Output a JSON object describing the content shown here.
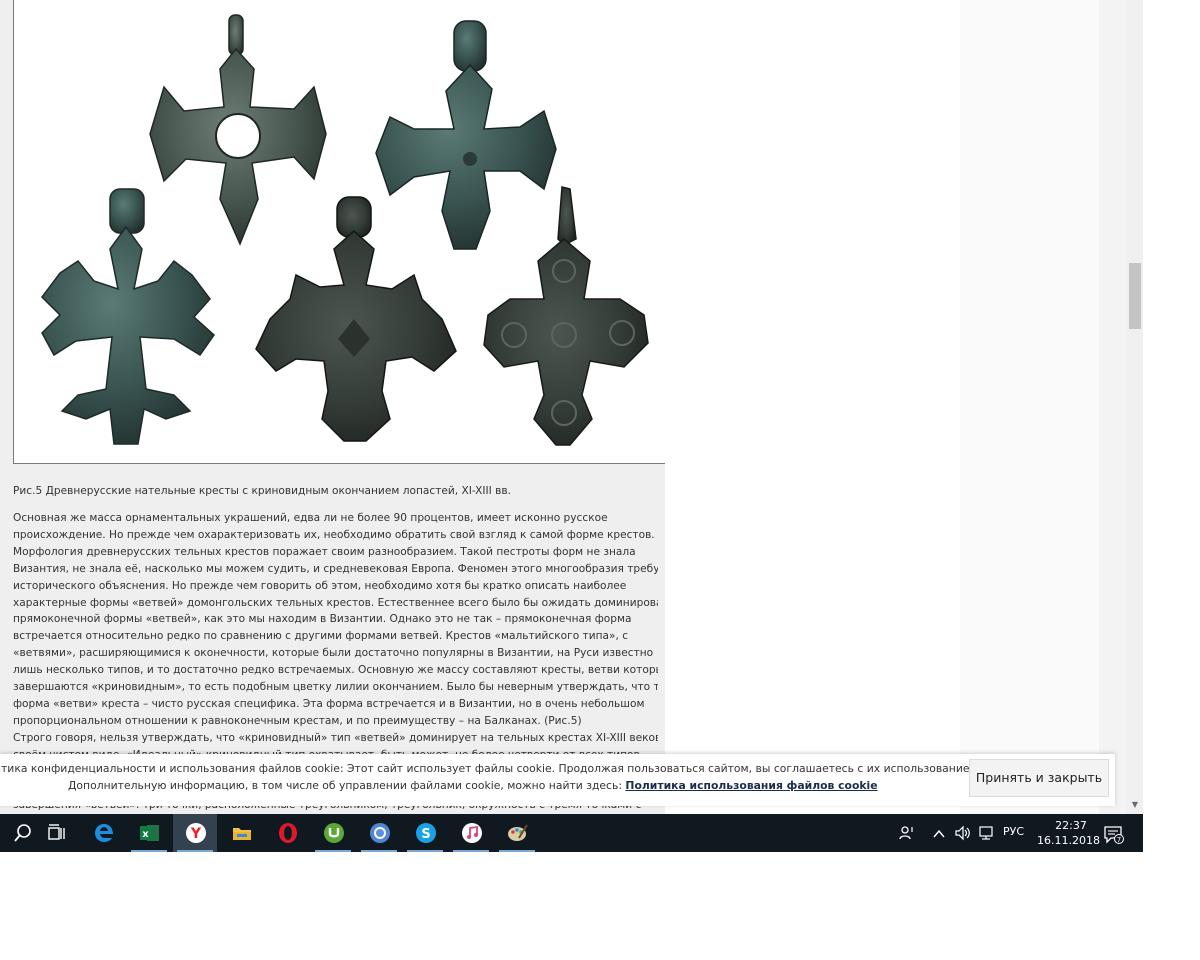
{
  "article": {
    "caption": "Рис.5 Древнерусские нательные кресты с криновидным окончанием лопастей, XI-XIII вв.",
    "lines": [
      "Основная же масса орнаментальных украшений, едва ли не более 90 процентов, имеет исконно русское",
      "происхождение. Но прежде чем охарактеризовать их, необходимо обратить свой взгляд к самой форме крестов.",
      "Морфология древнерусских тельных крестов поражает своим разнообразием. Такой пестроты форм не знала",
      "Византия, не знала её, насколько мы можем судить, и средневековая Европа. Феномен этого многообразия требует",
      "исторического объяснения. Но прежде чем говорить об этом, необходимо хотя бы кратко описать наиболее",
      "характерные формы «ветвей» домонгольских тельных крестов. Естественнее всего было бы ожидать доминирование",
      "прямоконечной формы «ветвей», как это мы находим в Византии. Однако это не так – прямоконечная форма",
      "встречается относительно редко по сравнению с другими формами ветвей. Крестов «мальтийского типа», с",
      "«ветвями», расширяющимися к оконечности, которые были достаточно популярны в Византии, на Руси известно",
      "лишь несколько типов, и то достаточно редко встречаемых. Основную же массу составляют кресты, ветви которых",
      "завершаются «криновидным», то есть подобным цветку лилии окончанием. Было бы неверным утверждать, что такая",
      "форма «ветви» креста – чисто русская специфика. Эта форма встречается и в Византии, но в очень небольшом",
      "пропорциональном отношении к равноконечным крестам, и по преимуществу – на Балканах. (Рис.5)",
      "Строго говоря, нельзя утверждать, что «криновидный» тип «ветвей» доминирует на тельных крестах XI-XIII веков в",
      "своём чистом виде. «Идеальный» криновидный тип охватывает, быть может, не более четверти от всех типов"
    ],
    "below_cookie_line": "завершения «ветвей»: три точки, расположенные треугольником, треугольник, окружность с тремя точками с"
  },
  "cookie": {
    "line1": "итика конфиденциальности и использования файлов cookie: Этот сайт использует файлы cookie. Продолжая пользоваться сайтом, вы соглашаетесь с их использованием.",
    "line2": "Дополнительную информацию, в том числе об управлении файлами cookie, можно найти здесь: ",
    "link": "Политика использования файлов cookie",
    "accept": "Принять и закрыть"
  },
  "taskbar": {
    "apps": [
      "search",
      "task-view",
      "edge",
      "excel",
      "yandex-browser",
      "file-explorer",
      "opera",
      "utorrent",
      "chrome",
      "skype",
      "itunes",
      "paint"
    ],
    "language": "РУС",
    "time": "22:37",
    "date": "16.11.2018",
    "notifications": "7"
  },
  "colors": {
    "bronze_dark": "#3d4a44",
    "bronze_mid": "#56655e",
    "taskbar": "#101820",
    "article_bg": "#efefef"
  }
}
